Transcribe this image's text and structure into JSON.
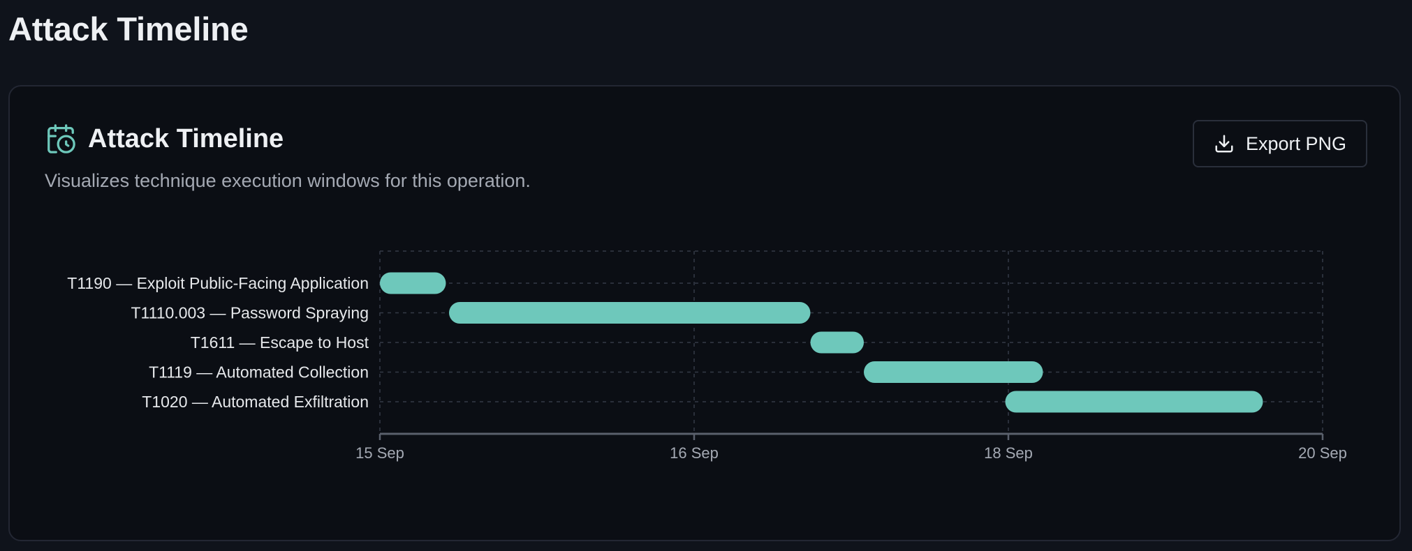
{
  "page": {
    "title": "Attack Timeline"
  },
  "card": {
    "title": "Attack Timeline",
    "description": "Visualizes technique execution windows for this operation.",
    "title_icon": "calendar-clock-icon",
    "export_button": {
      "label": "Export PNG",
      "icon": "download-icon"
    }
  },
  "colors": {
    "bar": "#6ec8bb",
    "accent_icon": "#6ec8bb",
    "grid": "#343a46",
    "axis": "#5a606c",
    "label": "#e6e8eb",
    "tick_label": "#a4a9b3"
  },
  "chart_data": {
    "type": "gantt",
    "title": "",
    "xlabel": "",
    "ylabel": "",
    "x_axis": "date",
    "x_ticks": [
      "15 Sep",
      "16 Sep",
      "18 Sep",
      "20 Sep"
    ],
    "x_tick_values": [
      0,
      1,
      2,
      3
    ],
    "x_range": [
      0,
      3
    ],
    "grid": true,
    "tasks": [
      {
        "label": "T1190 — Exploit Public-Facing Application",
        "start": 0.0,
        "end": 0.21
      },
      {
        "label": "T1110.003 — Password Spraying",
        "start": 0.22,
        "end": 1.37
      },
      {
        "label": "T1611 — Escape to Host",
        "start": 1.37,
        "end": 1.54
      },
      {
        "label": "T1119 — Automated Collection",
        "start": 1.54,
        "end": 2.11
      },
      {
        "label": "T1020 — Automated Exfiltration",
        "start": 1.99,
        "end": 2.81
      }
    ]
  }
}
